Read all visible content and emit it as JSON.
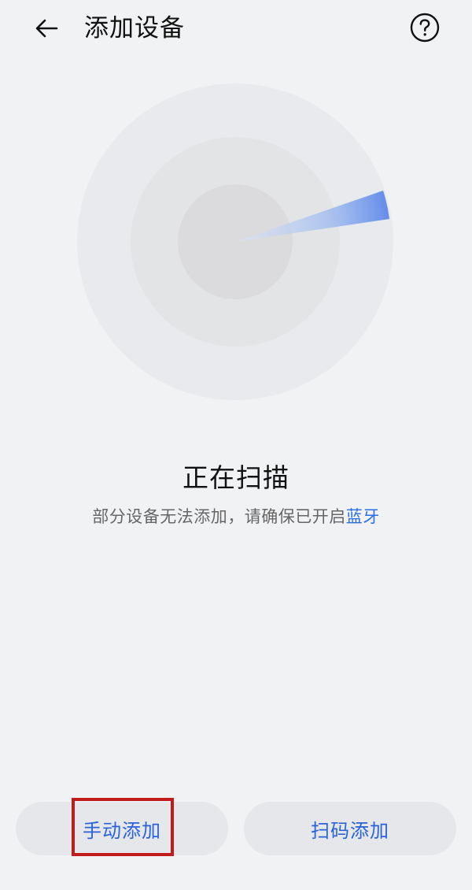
{
  "header": {
    "title": "添加设备",
    "back_icon": "arrow-left-icon",
    "help_icon": "help-circle-icon"
  },
  "scan": {
    "status_text": "正在扫描",
    "hint_prefix": "部分设备无法添加，请确保已开启",
    "hint_link": "蓝牙"
  },
  "actions": {
    "manual_add": "手动添加",
    "qr_add": "扫码添加"
  },
  "colors": {
    "background": "#f1f2f4",
    "accent": "#2a63d9",
    "annotation": "#c21b1b"
  }
}
